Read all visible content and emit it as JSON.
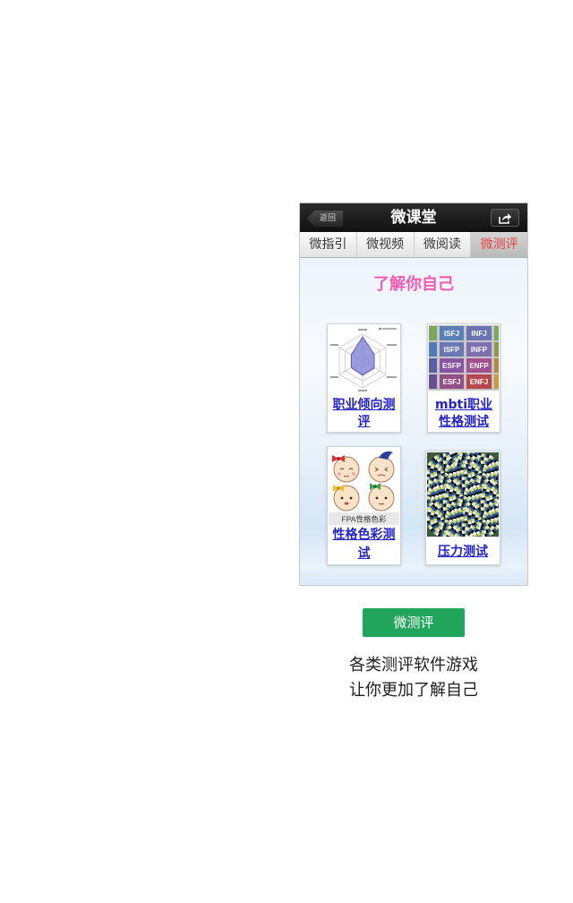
{
  "colors": {
    "accent_green": "#21a45b",
    "title_pink": "#f25ab2",
    "active_tab_red": "#e8413f",
    "link_blue": "#2424c4"
  },
  "header": {
    "back_label": "返回",
    "title": "微课堂",
    "share_icon": "share-icon"
  },
  "tabs": [
    {
      "label": "微指引",
      "active": false
    },
    {
      "label": "微视频",
      "active": false
    },
    {
      "label": "微阅读",
      "active": false
    },
    {
      "label": "微测评",
      "active": true
    }
  ],
  "content": {
    "title": "了解你自己",
    "cards": [
      {
        "label": "职业倾向测评"
      },
      {
        "label": "mbti职业性格测试",
        "tiles": [
          "ISFJ",
          "INFJ",
          "ISFP",
          "INFP",
          "ESFP",
          "ENFP",
          "ESFJ",
          "ENFJ"
        ]
      },
      {
        "label": "性格色彩测试",
        "image_caption": "FPA性格色彩"
      },
      {
        "label": "压力测试"
      }
    ]
  },
  "cta": {
    "label": "微测评"
  },
  "caption": {
    "lines": [
      "各类测评软件游戏",
      "让你更加了解自己"
    ]
  }
}
